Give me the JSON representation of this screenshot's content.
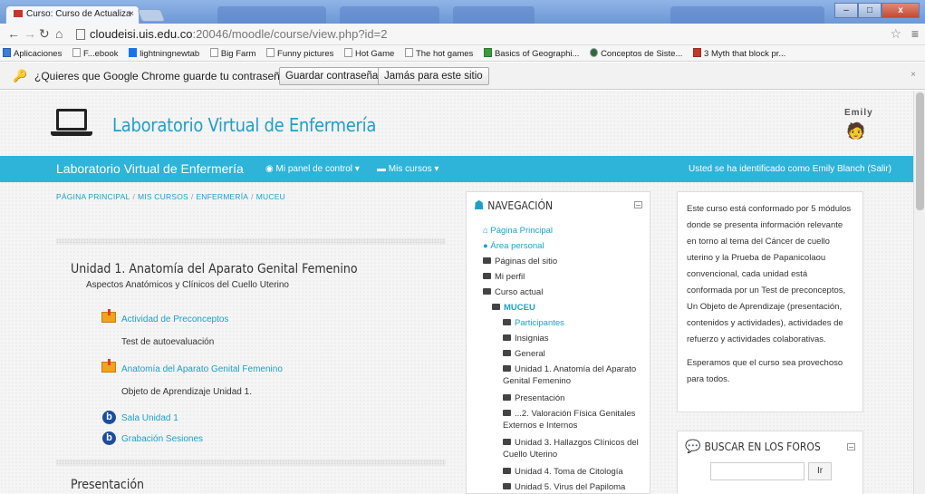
{
  "browser": {
    "tab_title": "Curso: Curso de Actualiza",
    "tab_close": "×",
    "url_host": "cloudeisi.uis.edu.co",
    "url_rest": ":20046/moodle/course/view.php?id=2",
    "window_buttons": [
      "–",
      "□",
      "x"
    ],
    "bookmarks": [
      "Aplicaciones",
      "F...ebook",
      "lightningnewtab",
      "Big Farm",
      "Funny pictures",
      "Hot Game",
      "The hot games",
      "Basics of Geographi...",
      "Conceptos de Siste...",
      "3 Myth that block pr..."
    ]
  },
  "password_bar": {
    "question": "¿Quieres que Google Chrome guarde tu contraseña?",
    "save_label": "Guardar contraseña",
    "never_label": "Jamás para este sitio",
    "close": "×"
  },
  "header": {
    "site_title": "Laboratorio Virtual de Enfermería",
    "user_name": "Emily"
  },
  "navbar": {
    "brand": "Laboratorio Virtual de Enfermería",
    "dashboard": "Mi panel de control",
    "courses": "Mis cursos",
    "login_info": "Usted se ha identificado como Emily Blanch (Salir)"
  },
  "breadcrumb": [
    "PÁGINA PRINCIPAL",
    "MIS CURSOS",
    "ENFERMERÍA",
    "MUCEU"
  ],
  "sections": {
    "unit1": {
      "title": "Unidad 1. Anatomía del Aparato Genital Femenino",
      "subtitle": "Aspectos Anatómicos y Clínicos del Cuello Uterino",
      "activities": [
        {
          "name": "Actividad de Preconceptos",
          "desc": "Test de autoevaluación"
        },
        {
          "name": "Anatomía del Aparato Genital Femenino",
          "desc": "Objeto de Aprendizaje Unidad 1."
        },
        {
          "name": "Sala Unidad 1"
        },
        {
          "name": "Grabación Sesiones"
        }
      ]
    },
    "presentacion": {
      "title": "Presentación"
    }
  },
  "navigation": {
    "title": "NAVEGACIÓN",
    "items": [
      "Página Principal",
      "Área personal",
      "Páginas del sitio",
      "Mi perfil",
      "Curso actual",
      "MUCEU",
      "Participantes",
      "Insignias",
      "General",
      "Unidad 1. Anatomía del Aparato",
      "Genital Femenino",
      "Presentación",
      "...2. Valoración Física Genitales",
      "Externos e Internos",
      "Unidad 3. Hallazgos Clínicos del",
      "Cuello Uterino",
      "Unidad 4. Toma de Citología",
      "Unidad 5. Virus del Papiloma"
    ]
  },
  "info_block": {
    "p1": "Este curso está conformado por 5 módulos donde se presenta información relevante en torno al tema del Cáncer de cuello uterino y la Prueba de Papanicolaou convencional, cada unidad está conformada por un Test de preconceptos, Un Objeto de Aprendizaje (presentación, contenidos y actividades), actividades de refuerzo y actividades colaborativas.",
    "p2": "Esperamos que el curso sea provechoso para todos."
  },
  "forum_block": {
    "title": "BUSCAR EN LOS FOROS",
    "button": "Ir"
  },
  "colors": {
    "accent": "#2eb3d9",
    "link": "#1fa0c8"
  }
}
